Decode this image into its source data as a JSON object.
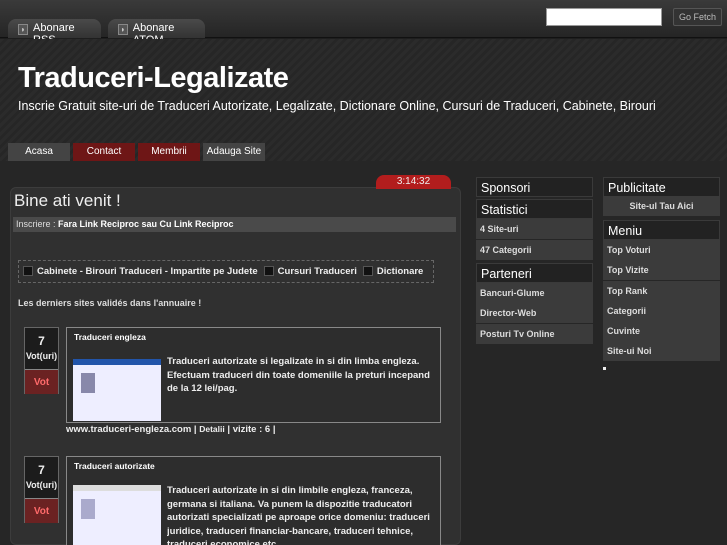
{
  "topbar": {
    "rss_label": "Abonare RSS",
    "atom_label": "Abonare ATOM",
    "search_value": "",
    "go_label": "Go Fetch"
  },
  "header": {
    "title": "Traduceri-Legalizate",
    "subtitle": "Inscrie Gratuit site-uri de Traduceri Autorizate, Legalizate, Dictionare Online, Cursuri de Traduceri, Cabinete, Birouri"
  },
  "nav": [
    "Acasa",
    "Contact",
    "Membrii",
    "Adauga Site"
  ],
  "main": {
    "clock": "3:14:32",
    "welcome": "Bine ati venit !",
    "inscriere_prefix": "Inscriere : ",
    "inscriere_link": "Fara Link Reciproc sau Cu Link Reciproc",
    "categories": [
      "Cabinete - Birouri Traduceri - Impartite pe Judete",
      "Cursuri Traduceri",
      "Dictionare"
    ],
    "derniers": "Les derniers sites validés dans l'annuaire !",
    "entries": [
      {
        "votes": "7",
        "votes_label": "Vot(uri)",
        "vote_button": "Vot",
        "title": "Traduceri engleza",
        "description": "Traduceri autorizate si legalizate in si din limba engleza. Efectuam traduceri din toate domeniile la preturi incepand de la 12 lei/pag.",
        "url": "www.traduceri-engleza.com",
        "details": "Detalii",
        "visits": "vizite : 6"
      },
      {
        "votes": "7",
        "votes_label": "Vot(uri)",
        "vote_button": "Vot",
        "title": "Traduceri autorizate",
        "description": "Traduceri autorizate in si din limbile engleza, franceza, germana si italiana. Va punem la dispozitie traducatori autorizati specializati pe aproape orice domeniu: traduceri juridice, traduceri financiar-bancare, traduceri tehnice, traduceri economice etc."
      }
    ]
  },
  "sidebar_left": {
    "sponsori": "Sponsori",
    "statistici": "Statistici",
    "stats": [
      "4 Site-uri",
      "47 Categorii"
    ],
    "parteneri": "Parteneri",
    "partners": [
      "Bancuri-Glume",
      "Director-Web",
      "Posturi Tv Online"
    ]
  },
  "sidebar_right": {
    "publicitate": "Publicitate",
    "ad_link": "Site-ul Tau Aici",
    "meniu": "Meniu",
    "menu_items": [
      "Top Voturi",
      "Top Vizite",
      "Top Rank",
      "Categorii",
      "Cuvinte",
      "Site-ui Noi"
    ]
  }
}
